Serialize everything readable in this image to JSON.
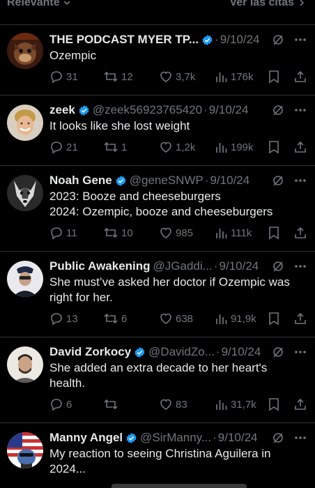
{
  "topbar": {
    "sort_label": "Relevante",
    "quotes_label": "Ver las citas"
  },
  "colors": {
    "background": "#000000",
    "text": "#e7e9ea",
    "muted": "#71767b",
    "verified": "#1d9bf0",
    "divider": "#2f3336"
  },
  "tweets": [
    {
      "name": "THE PODCAST MYER TP...",
      "handle": "",
      "date": "9/10/24",
      "verified": true,
      "lines": [
        "Ozempic"
      ],
      "replies": "31",
      "retweets": "12",
      "likes": "3,7k",
      "views": "176k"
    },
    {
      "name": "zeek",
      "handle": "@zeek56923765420",
      "date": "9/10/24",
      "verified": true,
      "lines": [
        "It looks like she lost weight"
      ],
      "replies": "21",
      "retweets": "1",
      "likes": "1,2k",
      "views": "199k"
    },
    {
      "name": "Noah Gene",
      "handle": "@geneSNWP",
      "date": "9/10/24",
      "verified": true,
      "lines": [
        "2023: Booze and cheeseburgers",
        "2024: Ozempic, booze and cheeseburgers"
      ],
      "replies": "11",
      "retweets": "10",
      "likes": "985",
      "views": "111k"
    },
    {
      "name": "Public Awakening",
      "handle": "@JGaddi...",
      "date": "9/10/24",
      "verified": false,
      "lines": [
        "She must’ve asked her doctor if Ozempic was",
        "right for her."
      ],
      "replies": "13",
      "retweets": "6",
      "likes": "638",
      "views": "91,9k"
    },
    {
      "name": "David Zorkocy",
      "handle": "@DavidZo...",
      "date": "9/10/24",
      "verified": true,
      "lines": [
        "She added an extra decade to her heart's",
        "health."
      ],
      "replies": "6",
      "retweets": "",
      "likes": "83",
      "views": "31,7k"
    },
    {
      "name": "Manny Angel",
      "handle": "@SirManny...",
      "date": "9/10/24",
      "verified": true,
      "lines": [
        "My reaction to seeing Christina Aguilera in",
        "2024..."
      ],
      "replies": "",
      "retweets": "",
      "likes": "",
      "views": ""
    }
  ]
}
